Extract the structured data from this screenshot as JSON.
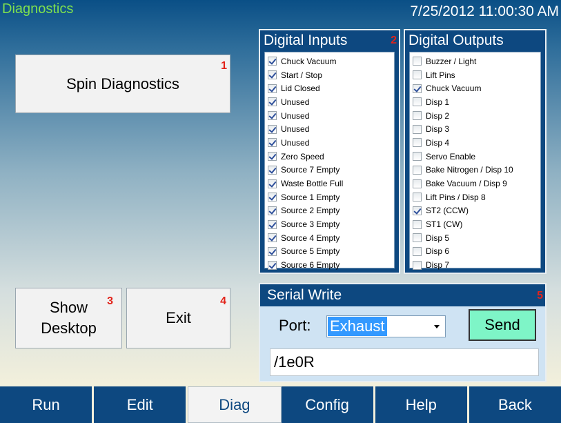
{
  "app": {
    "title": "Diagnostics",
    "datetime": "7/25/2012 11:00:30 AM"
  },
  "buttons": {
    "spin_diagnostics": "Spin Diagnostics",
    "spin_badge": "1",
    "show_desktop_line1": "Show",
    "show_desktop_line2": "Desktop",
    "show_desktop_badge": "3",
    "exit": "Exit",
    "exit_badge": "4"
  },
  "digital_inputs": {
    "title": "Digital Inputs",
    "badge": "2",
    "items": [
      {
        "label": "Chuck Vacuum",
        "checked": true
      },
      {
        "label": "Start / Stop",
        "checked": true
      },
      {
        "label": "Lid Closed",
        "checked": true
      },
      {
        "label": "Unused",
        "checked": true
      },
      {
        "label": "Unused",
        "checked": true
      },
      {
        "label": "Unused",
        "checked": true
      },
      {
        "label": "Unused",
        "checked": true
      },
      {
        "label": "Zero Speed",
        "checked": true
      },
      {
        "label": "Source 7 Empty",
        "checked": true
      },
      {
        "label": "Waste Bottle Full",
        "checked": true
      },
      {
        "label": "Source 1 Empty",
        "checked": true
      },
      {
        "label": "Source 2 Empty",
        "checked": true
      },
      {
        "label": "Source 3 Empty",
        "checked": true
      },
      {
        "label": "Source 4 Empty",
        "checked": true
      },
      {
        "label": "Source 5 Empty",
        "checked": true
      },
      {
        "label": "Source 6 Empty",
        "checked": true
      }
    ]
  },
  "digital_outputs": {
    "title": "Digital Outputs",
    "items": [
      {
        "label": "Buzzer / Light",
        "checked": false
      },
      {
        "label": "Lift Pins",
        "checked": false
      },
      {
        "label": "Chuck Vacuum",
        "checked": true
      },
      {
        "label": "Disp 1",
        "checked": false
      },
      {
        "label": "Disp 2",
        "checked": false
      },
      {
        "label": "Disp 3",
        "checked": false
      },
      {
        "label": "Disp 4",
        "checked": false
      },
      {
        "label": "Servo Enable",
        "checked": false
      },
      {
        "label": "Bake Nitrogen / Disp 10",
        "checked": false
      },
      {
        "label": "Bake Vacuum / Disp 9",
        "checked": false
      },
      {
        "label": "Lift Pins / Disp 8",
        "checked": false
      },
      {
        "label": "ST2 (CCW)",
        "checked": true
      },
      {
        "label": "ST1 (CW)",
        "checked": false
      },
      {
        "label": "Disp 5",
        "checked": false
      },
      {
        "label": "Disp 6",
        "checked": false
      },
      {
        "label": "Disp 7",
        "checked": false
      }
    ]
  },
  "serial_write": {
    "title": "Serial Write",
    "badge": "5",
    "port_label": "Port:",
    "port_value": "Exhaust",
    "send_label": "Send",
    "command_value": "/1e0R"
  },
  "tabs": [
    {
      "label": "Run",
      "active": false
    },
    {
      "label": "Edit",
      "active": false
    },
    {
      "label": "Diag",
      "active": true
    },
    {
      "label": "Config",
      "active": false
    },
    {
      "label": "Help",
      "active": false
    },
    {
      "label": "Back",
      "active": false
    }
  ]
}
